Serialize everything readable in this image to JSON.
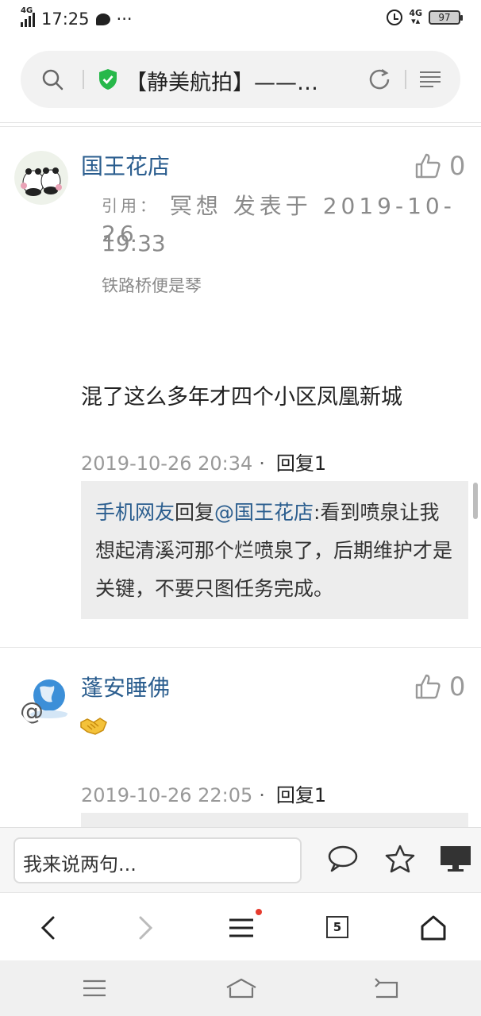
{
  "status_bar": {
    "network_left": "4G",
    "time": "17:25",
    "more": "···",
    "network_right": "4G",
    "battery": "97"
  },
  "address_bar": {
    "title": "【静美航拍】——…"
  },
  "comments": [
    {
      "username": "国王花店",
      "likes": "0",
      "quote": {
        "label": "引用：",
        "author_line": "冥想 发表于 2019-10-26",
        "time": "19:33",
        "text": "铁路桥便是琴"
      },
      "content": "混了这么多年才四个小区凤凰新城",
      "timestamp": "2019-10-26 20:34",
      "reply_label": "回复1",
      "sub_reply": {
        "author": "手机网友",
        "prefix": "回复",
        "target": "@国王花店",
        "text": ":看到喷泉让我想起清溪河那个烂喷泉了，后期维护才是关键，不要只图任务完成。"
      }
    },
    {
      "username": "蓬安睡佛",
      "likes": "0",
      "emoji": "handshake-emoji",
      "timestamp": "2019-10-26 22:05",
      "reply_label": "回复1"
    }
  ],
  "comment_input": {
    "placeholder": "我来说两句..."
  },
  "browser_nav": {
    "tab_count": "5"
  },
  "colors": {
    "link_blue": "#2a5d8e",
    "shield_green": "#27b84a",
    "notification_red": "#e63b2e"
  }
}
